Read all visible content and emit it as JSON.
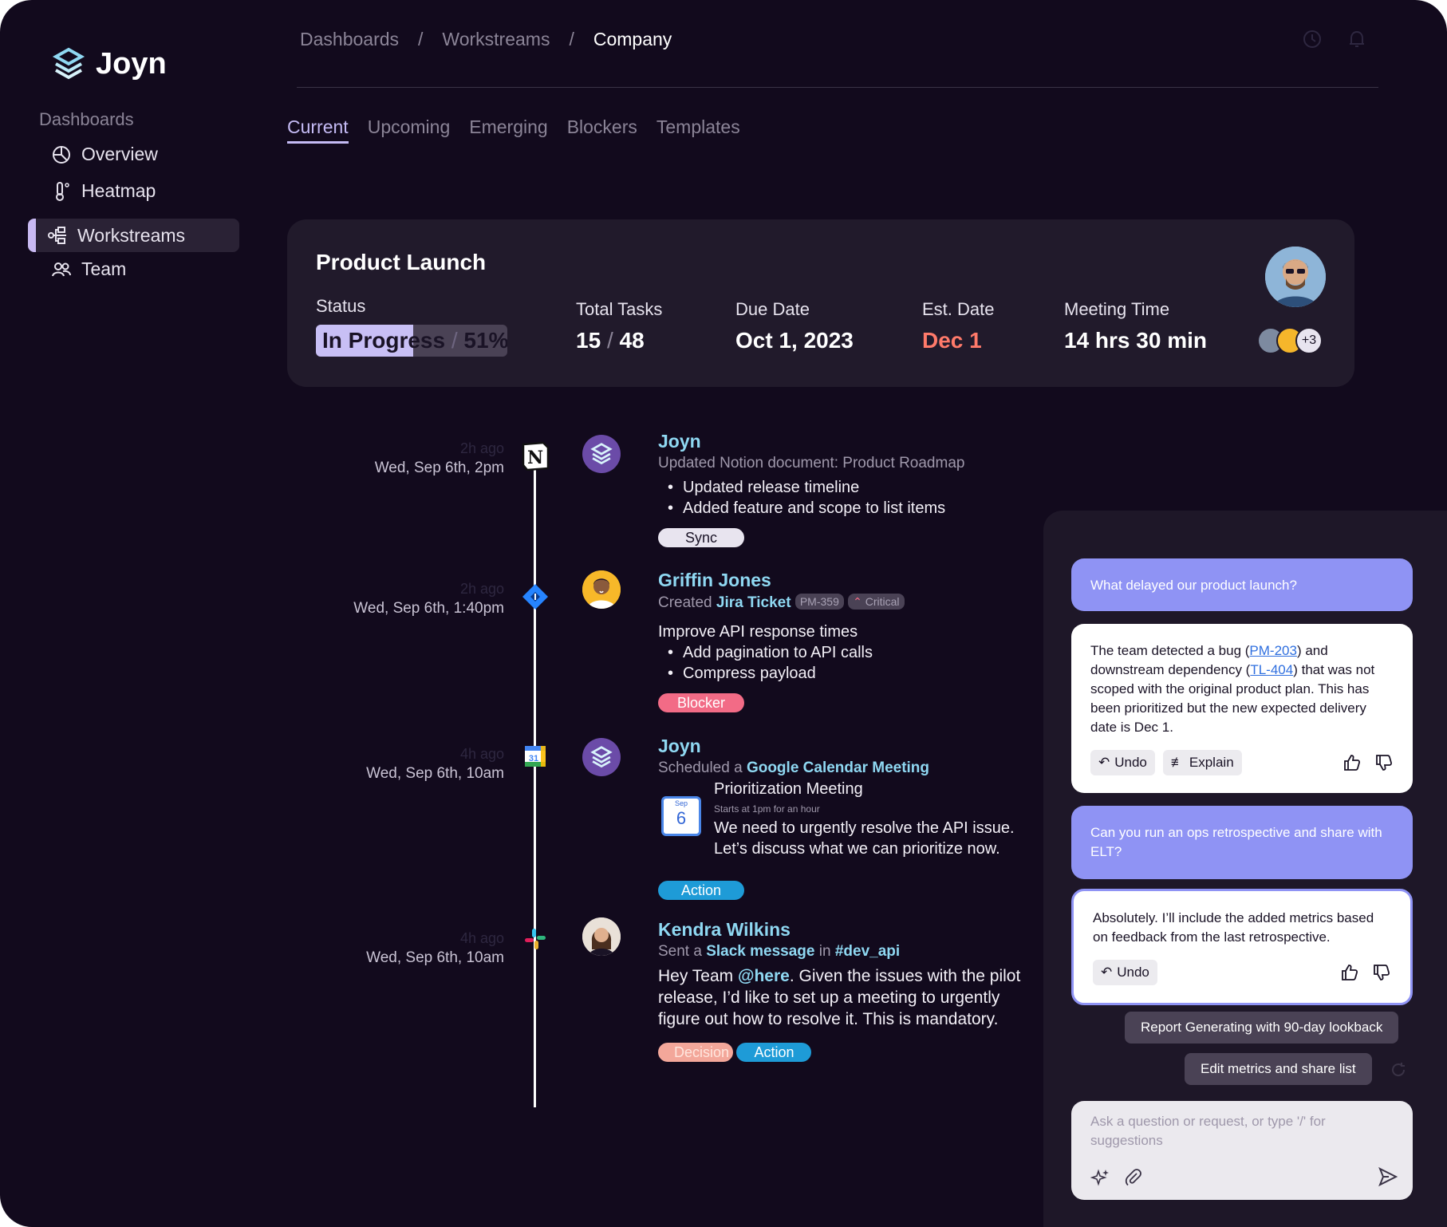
{
  "app": {
    "name": "Joyn"
  },
  "sidebar": {
    "section": "Dashboards",
    "items": [
      {
        "label": "Overview",
        "icon": "pie-chart-icon"
      },
      {
        "label": "Heatmap",
        "icon": "thermometer-icon"
      },
      {
        "label": "Workstreams",
        "icon": "workflow-icon",
        "active": true
      },
      {
        "label": "Team",
        "icon": "people-icon"
      }
    ]
  },
  "breadcrumb": [
    "Dashboards",
    "Workstreams",
    "Company"
  ],
  "breadcrumb_sep": "/",
  "tabs": [
    "Current",
    "Upcoming",
    "Emerging",
    "Blockers",
    "Templates"
  ],
  "card": {
    "title": "Product Launch",
    "status_label": "Status",
    "status_text": "In Progress",
    "status_sep": "/",
    "progress_pct": "51%",
    "progress_value": 51,
    "total_tasks_label": "Total Tasks",
    "tasks_done": "15",
    "tasks_sep": "/",
    "tasks_total": "48",
    "due_label": "Due Date",
    "due_value": "Oct 1, 2023",
    "est_label": "Est. Date",
    "est_value": "Dec 1",
    "meeting_label": "Meeting Time",
    "meeting_value": "14 hrs 30 min",
    "avatars_more": "+3"
  },
  "timeline": [
    {
      "ago": "2h ago",
      "date": "Wed, Sep 6th, 2pm",
      "name": "Joyn",
      "sub": "Updated Notion document: Product Roadmap",
      "bullets": [
        "Updated release timeline",
        "Added feature and scope to list items"
      ],
      "chip": "Sync"
    },
    {
      "ago": "2h ago",
      "date": "Wed, Sep 6th, 1:40pm",
      "name": "Griffin Jones",
      "sub_prefix": "Created",
      "sub_bold": "Jira Ticket",
      "tag1": "PM-359",
      "tag2": "Critical",
      "text": "Improve API response times",
      "bullets": [
        "Add pagination to API calls",
        "Compress payload"
      ],
      "chip": "Blocker"
    },
    {
      "ago": "4h ago",
      "date": "Wed, Sep 6th, 10am",
      "name": "Joyn",
      "sub_prefix": "Scheduled a",
      "sub_bold": "Google Calendar Meeting",
      "cal_month": "Sep",
      "cal_day": "6",
      "meeting_title": "Prioritization Meeting",
      "meeting_sub": "Starts at 1pm for an hour",
      "meeting_text": "We need to urgently resolve the API issue. Let’s discuss what we can prioritize now.",
      "chip": "Action"
    },
    {
      "ago": "4h ago",
      "date": "Wed, Sep 6th, 10am",
      "name": "Kendra Wilkins",
      "sub_prefix": "Sent a",
      "sub_bold": "Slack message",
      "sub_mid": "in",
      "sub_channel": "#dev_api",
      "text_pre": "Hey Team ",
      "mention": "@here",
      "text_post": ". Given the issues with the pilot release, I’d like to set up a meeting to urgently figure out how to resolve it. This is mandatory.",
      "chip1": "Decision",
      "chip2": "Action"
    }
  ],
  "chat": {
    "q1": "What delayed our product launch?",
    "a1_pre": "The team detected a bug (",
    "a1_link1": "PM-203",
    "a1_mid": ") and downstream dependency (",
    "a1_link2": "TL-404",
    "a1_post": ") that was not scoped with the original product plan. This has been prioritized but the new expected delivery date is Dec 1.",
    "undo": "Undo",
    "explain": "Explain",
    "q2": "Can you run an ops retrospective and share with ELT?",
    "a2": "Absolutely. I’ll include the added metrics based on feedback from the last retrospective.",
    "suggestion1": "Report Generating with 90-day lookback",
    "suggestion2": "Edit metrics and share list",
    "input_placeholder": "Ask a question or request, or type '/' for suggestions"
  },
  "colors": {
    "accent": "#c5bbf5",
    "est_date": "#ff7a6a",
    "chat_user": "#8f93f4",
    "link": "#8fd8f2"
  }
}
